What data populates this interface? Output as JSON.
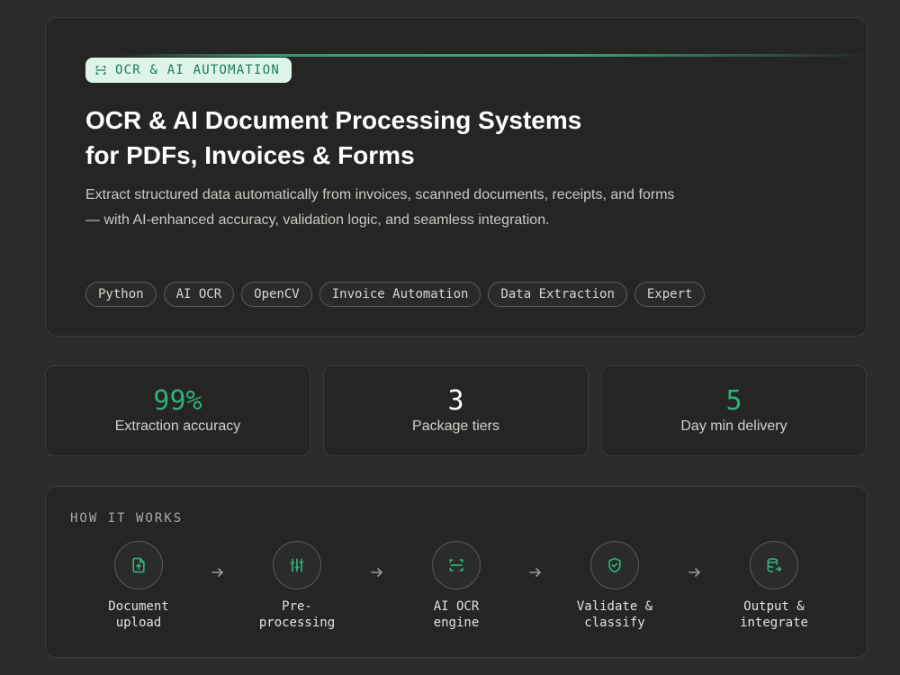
{
  "hero": {
    "badge": "OCR & AI AUTOMATION",
    "title_line1": "OCR & AI Document Processing Systems",
    "title_line2": "for PDFs, Invoices & Forms",
    "description": "Extract structured data automatically from invoices, scanned documents, receipts, and forms — with AI-enhanced accuracy, validation logic, and seamless integration.",
    "tags": [
      "Python",
      "AI OCR",
      "OpenCV",
      "Invoice Automation",
      "Data Extraction",
      "Expert"
    ]
  },
  "stats": [
    {
      "value": "99%",
      "label": "Extraction accuracy"
    },
    {
      "value": "3",
      "label": "Package tiers"
    },
    {
      "value": "5",
      "label": "Day min delivery"
    }
  ],
  "how_it_works": {
    "title": "HOW IT WORKS",
    "steps": [
      {
        "label": "Document\nupload",
        "icon": "file-upload-icon"
      },
      {
        "label": "Pre-\nprocessing",
        "icon": "sliders-icon"
      },
      {
        "label": "AI OCR\nengine",
        "icon": "scan-icon"
      },
      {
        "label": "Validate &\nclassify",
        "icon": "shield-check-icon"
      },
      {
        "label": "Output &\nintegrate",
        "icon": "database-export-icon"
      }
    ]
  },
  "colors": {
    "accent": "#2fb07e",
    "badge_bg": "#dff4e9",
    "card_bg": "#252524",
    "page_bg": "#2b2b2a"
  }
}
